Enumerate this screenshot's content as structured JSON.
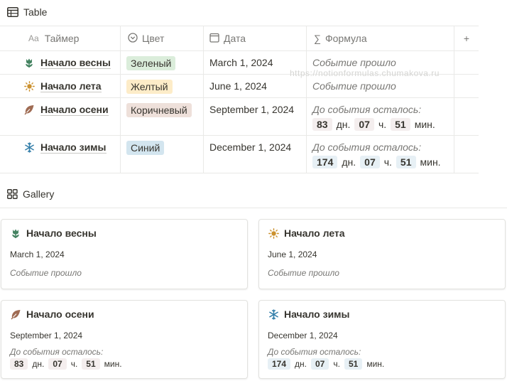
{
  "table_view": {
    "title": "Table",
    "columns": [
      {
        "label": "Таймер",
        "icon": "Aa"
      },
      {
        "label": "Цвет"
      },
      {
        "label": "Дата"
      },
      {
        "label": "Формула"
      }
    ],
    "add_column": "+",
    "rows": [
      {
        "name": "Начало весны",
        "color": "Зеленый",
        "date": "March 1, 2024",
        "formula": "Событие прошло"
      },
      {
        "name": "Начало лета",
        "color": "Желтый",
        "date": "June 1, 2024",
        "formula": "Событие прошло"
      },
      {
        "name": "Начало осени",
        "color": "Коричневый",
        "date": "September 1, 2024",
        "formula": "До события осталось:",
        "days": "83",
        "hours": "07",
        "minutes": "51"
      },
      {
        "name": "Начало зимы",
        "color": "Синий",
        "date": "December 1, 2024",
        "formula": "До события осталось:",
        "days": "174",
        "hours": "07",
        "minutes": "51"
      }
    ],
    "units": {
      "days": "дн.",
      "hours": "ч.",
      "minutes": "мин."
    }
  },
  "watermark": "https://notionformulas.chumakova.ru",
  "gallery_view": {
    "title": "Gallery",
    "cards": [
      {
        "name": "Начало весны",
        "date": "March 1, 2024",
        "formula": "Событие прошло"
      },
      {
        "name": "Начало лета",
        "date": "June 1, 2024",
        "formula": "Событие прошло"
      },
      {
        "name": "Начало осени",
        "date": "September 1, 2024",
        "formula": "До события осталось:",
        "days": "83",
        "hours": "07",
        "minutes": "51"
      },
      {
        "name": "Начало зимы",
        "date": "December 1, 2024",
        "formula": "До события осталось:",
        "days": "174",
        "hours": "07",
        "minutes": "51"
      }
    ]
  },
  "colors": {
    "green_bg": "#dbeddb",
    "yellow_bg": "#fdecc8",
    "brown_bg": "#eee0da",
    "blue_bg": "#d3e5ef",
    "spring_icon": "#448361",
    "summer_icon": "#cb912f",
    "autumn_icon": "#9f6b53",
    "winter_icon": "#337ea9"
  },
  "icons": [
    "table-icon",
    "gallery-icon",
    "tulip-icon",
    "sun-icon",
    "leaf-icon",
    "snowflake-icon",
    "color-select-icon",
    "calendar-icon",
    "sigma-icon"
  ]
}
